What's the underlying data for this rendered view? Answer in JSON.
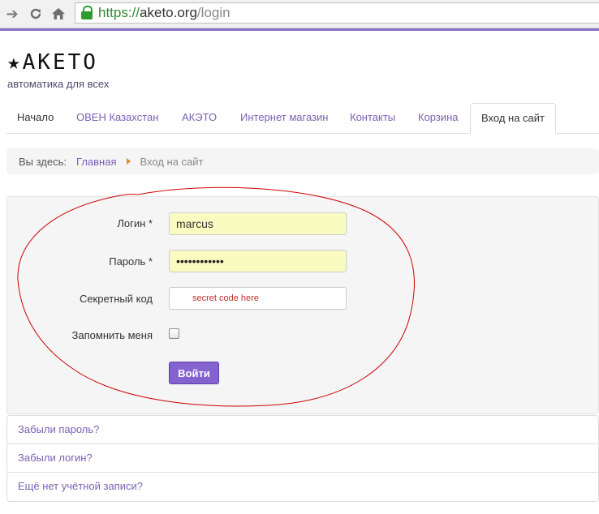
{
  "browser": {
    "back_icon": "arrow-right-icon",
    "reload_icon": "reload-icon",
    "home_icon": "home-icon",
    "url_scheme": "https://",
    "url_host": "aketo.org",
    "url_path": "/login"
  },
  "site": {
    "logo_text": "★AKETO",
    "tagline": "автоматика для всех"
  },
  "menu": {
    "items": [
      {
        "label": "Начало"
      },
      {
        "label": "ОВЕН Казахстан"
      },
      {
        "label": "АКЭТО"
      },
      {
        "label": "Интернет магазин"
      },
      {
        "label": "Контакты"
      },
      {
        "label": "Корзина"
      },
      {
        "label": "Вход на сайт"
      }
    ]
  },
  "breadcrumb": {
    "prefix": "Вы здесь:",
    "home": "Главная",
    "current": "Вход на сайт"
  },
  "login": {
    "login_label": "Логин *",
    "login_value": "marcus",
    "password_label": "Пароль *",
    "password_value": "••••••••••••",
    "secret_label": "Секретный код",
    "secret_hint": "secret code here",
    "remember_label": "Запомнить меня",
    "remember_checked": false,
    "submit_label": "Войти"
  },
  "links": {
    "forgot_password": "Забыли пароль?",
    "forgot_login": "Забыли логин?",
    "no_account": "Ещё нет учётной записи?"
  },
  "colors": {
    "accent": "#8463d0",
    "link": "#7a62b5",
    "annotation": "#cc0000",
    "autofill": "#fafbc0"
  }
}
